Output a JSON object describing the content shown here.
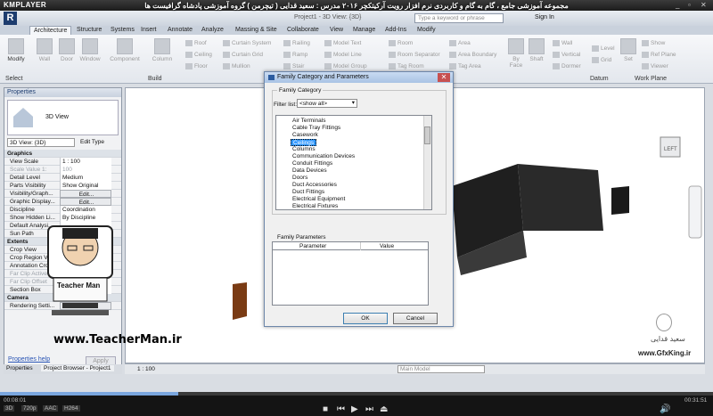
{
  "player": {
    "logo": "KMPLAYER",
    "controls": [
      "_",
      "▫",
      "✕"
    ],
    "time_current": "00:08:01",
    "time_total": "00:31:51",
    "progress_fraction": 0.25,
    "badges": [
      "3D",
      "720p",
      "AAC",
      "H264"
    ]
  },
  "course_title": "مجموعه آموزشی جامع ، گام به گام و کاربردی نرم افزار رویت آرکیتکچر ۲۰۱۶ مدرس : سعید قدایی ( تیچرمن ) گروه آموزشی پادشاه گرافیست ها",
  "revit": {
    "doc_title": "Project1 - 3D View: {3D}",
    "search_placeholder": "Type a keyword or phrase",
    "sign_in": "Sign In",
    "tabs": [
      "Architecture",
      "Structure",
      "Systems",
      "Insert",
      "Annotate",
      "Analyze",
      "Massing & Site",
      "Collaborate",
      "View",
      "Manage",
      "Add-Ins",
      "Modify"
    ],
    "ribbon": {
      "modify": "Modify",
      "wall": "Wall",
      "door": "Door",
      "window": "Window",
      "component": "Component",
      "column": "Column",
      "roof": "Roof",
      "ceiling": "Ceiling",
      "floor": "Floor",
      "curtain_system": "Curtain System",
      "curtain_grid": "Curtain Grid",
      "mullion": "Mullion",
      "railing": "Railing",
      "ramp": "Ramp",
      "stair": "Stair",
      "model_text": "Model Text",
      "model_line": "Model Line",
      "model_group": "Model Group",
      "room": "Room",
      "room_separator": "Room Separator",
      "tag_room": "Tag Room",
      "area": "Area",
      "area_boundary": "Area Boundary",
      "tag_area": "Tag Area",
      "by_face": "By Face",
      "shaft": "Shaft",
      "wall_opening": "Wall",
      "vertical": "Vertical",
      "dormer": "Dormer",
      "level": "Level",
      "grid": "Grid",
      "set": "Set",
      "show": "Show",
      "ref_plane": "Ref Plane",
      "viewer": "Viewer",
      "panels": {
        "select": "Select",
        "build": "Build",
        "datum": "Datum",
        "work_plane": "Work Plane"
      }
    },
    "properties": {
      "title": "Properties",
      "type_name": "3D View",
      "instance_selector": "3D View: {3D}",
      "edit_type": "Edit Type",
      "rows": [
        {
          "k": "Graphics",
          "group": true
        },
        {
          "k": "View Scale",
          "v": "1 : 100"
        },
        {
          "k": "Scale Value    1:",
          "v": "100",
          "gray": true
        },
        {
          "k": "Detail Level",
          "v": "Medium"
        },
        {
          "k": "Parts Visibility",
          "v": "Show Original"
        },
        {
          "k": "Visibility/Graph...",
          "v": "Edit...",
          "btn": true
        },
        {
          "k": "Graphic Display...",
          "v": "Edit...",
          "btn": true
        },
        {
          "k": "Discipline",
          "v": "Coordination"
        },
        {
          "k": "Show Hidden Li...",
          "v": "By Discipline"
        },
        {
          "k": "Default Analysi...",
          "v": ""
        },
        {
          "k": "Sun Path",
          "v": ""
        },
        {
          "k": "Extents",
          "group": true
        },
        {
          "k": "Crop View",
          "v": ""
        },
        {
          "k": "Crop Region Vi...",
          "v": ""
        },
        {
          "k": "Annotation Cro...",
          "v": ""
        },
        {
          "k": "Far Clip Active",
          "v": "",
          "gray": true
        },
        {
          "k": "Far Clip Offset",
          "v": "304.8",
          "gray": true
        },
        {
          "k": "Section Box",
          "v": ""
        },
        {
          "k": "Camera",
          "group": true
        },
        {
          "k": "Rendering Setti...",
          "v": "Edit...",
          "btn": true
        }
      ],
      "help": "Properties help",
      "apply": "Apply"
    },
    "bottom_tabs": [
      "Properties",
      "Project Browser - Project1"
    ],
    "status": {
      "scale": "1 : 100",
      "model": "Main Model"
    }
  },
  "dialog": {
    "title": "Family Category and Parameters",
    "close": "✕",
    "category_label": "Family Category",
    "filter_label": "Filter list:",
    "filter_value": "<show all>",
    "categories": [
      "Air Terminals",
      "Cable Tray Fittings",
      "Casework",
      "Ceilings",
      "Columns",
      "Communication Devices",
      "Conduit Fittings",
      "Data Devices",
      "Doors",
      "Duct Accessories",
      "Duct Fittings",
      "Electrical Equipment",
      "Electrical Fixtures"
    ],
    "selected_category": "Ceilings",
    "parameters_label": "Family Parameters",
    "param_headers": [
      "Parameter",
      "Value"
    ],
    "ok": "OK",
    "cancel": "Cancel"
  },
  "overlays": {
    "teacher_url": "www.TeacherMan.ir",
    "teacher_name": "Teacher Man",
    "gfx_url": "www.GfxKing.ir",
    "gfx_name": "سعید قدایی"
  },
  "colors": {
    "selection": "#3399ff",
    "wall_dark": "#1f1f1f",
    "door": "#7a3b14"
  }
}
